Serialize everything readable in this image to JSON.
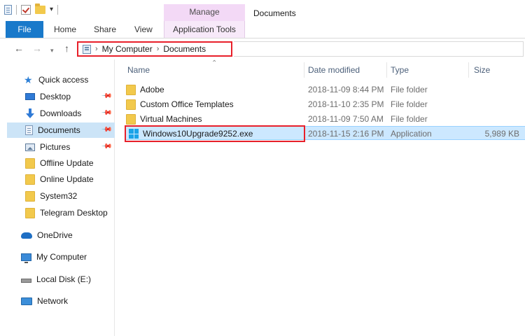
{
  "window": {
    "title": "Documents",
    "context_tab_label": "Manage"
  },
  "ribbon": {
    "tabs": [
      {
        "label": "File"
      },
      {
        "label": "Home"
      },
      {
        "label": "Share"
      },
      {
        "label": "View"
      },
      {
        "label": "Application Tools"
      }
    ]
  },
  "address_bar": {
    "crumbs": [
      "My Computer",
      "Documents"
    ],
    "highlight_color": "#e8202a"
  },
  "nav_pane": {
    "quick_access_label": "Quick access",
    "items": [
      {
        "label": "Desktop",
        "icon": "desktop-icon",
        "pinned": true
      },
      {
        "label": "Downloads",
        "icon": "download-icon",
        "pinned": true
      },
      {
        "label": "Documents",
        "icon": "documents-icon",
        "pinned": true,
        "selected": true
      },
      {
        "label": "Pictures",
        "icon": "pictures-icon",
        "pinned": true
      },
      {
        "label": "Offline Update",
        "icon": "folder-icon"
      },
      {
        "label": "Online Update",
        "icon": "folder-icon"
      },
      {
        "label": "System32",
        "icon": "folder-icon"
      },
      {
        "label": "Telegram Desktop",
        "icon": "folder-icon"
      }
    ],
    "roots": [
      {
        "label": "OneDrive",
        "icon": "onedrive-icon"
      },
      {
        "label": "My Computer",
        "icon": "computer-icon"
      },
      {
        "label": "Local Disk (E:)",
        "icon": "disk-icon"
      },
      {
        "label": "Network",
        "icon": "network-icon"
      }
    ]
  },
  "file_list": {
    "columns": [
      "Name",
      "Date modified",
      "Type",
      "Size"
    ],
    "rows": [
      {
        "name": "Adobe",
        "date": "2018-11-09 8:44 PM",
        "type": "File folder",
        "size": "",
        "icon": "folder-icon"
      },
      {
        "name": "Custom Office Templates",
        "date": "2018-11-10 2:35 PM",
        "type": "File folder",
        "size": "",
        "icon": "folder-icon"
      },
      {
        "name": "Virtual Machines",
        "date": "2018-11-09 7:50 AM",
        "type": "File folder",
        "size": "",
        "icon": "folder-icon"
      },
      {
        "name": "Windows10Upgrade9252.exe",
        "date": "2018-11-15 2:16 PM",
        "type": "Application",
        "size": "5,989 KB",
        "icon": "windows-app-icon",
        "selected": true
      }
    ]
  },
  "colors": {
    "accent": "#1979ca",
    "selection": "#cce8ff",
    "manage_tab": "#f3d9f6",
    "highlight_box": "#e8202a"
  }
}
